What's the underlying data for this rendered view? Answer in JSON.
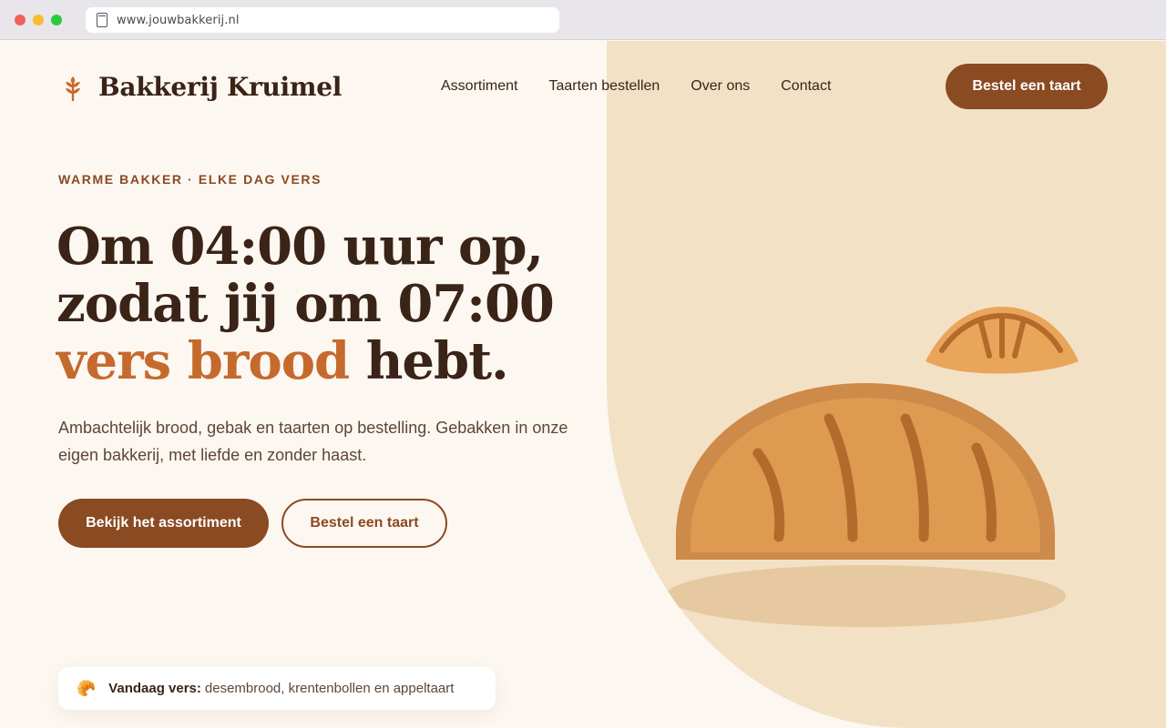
{
  "browser": {
    "url": "www.jouwbakkerij.nl"
  },
  "header": {
    "logo_text": "Bakkerij Kruimel",
    "logo_icon": "wheat-icon",
    "nav": [
      {
        "label": "Assortiment"
      },
      {
        "label": "Taarten bestellen"
      },
      {
        "label": "Over ons"
      },
      {
        "label": "Contact"
      }
    ],
    "cta_label": "Bestel een taart"
  },
  "hero": {
    "eyebrow": "WARME BAKKER · ELKE DAG VERS",
    "headline_line1": "Om 04:00 uur op,",
    "headline_line2": "zodat jij om 07:00",
    "headline_accent": "vers brood",
    "headline_end": " hebt.",
    "lead": "Ambachtelijk brood, gebak en taarten op bestelling. Gebakken in onze eigen bakkerij, met liefde en zonder haast.",
    "primary_button": "Bekijk het assortiment",
    "secondary_button": "Bestel een taart"
  },
  "today": {
    "icon": "croissant-icon",
    "label": "Vandaag vers:",
    "text": "desembrood, krentenbollen en appeltaart"
  },
  "colors": {
    "brand_brown": "#8a4a22",
    "accent_orange": "#c56a2d",
    "text_dark": "#3a2417",
    "page_bg": "#fdf7f1",
    "panel_bg": "#f3e1c6",
    "bread_fill": "#dd9a50"
  }
}
